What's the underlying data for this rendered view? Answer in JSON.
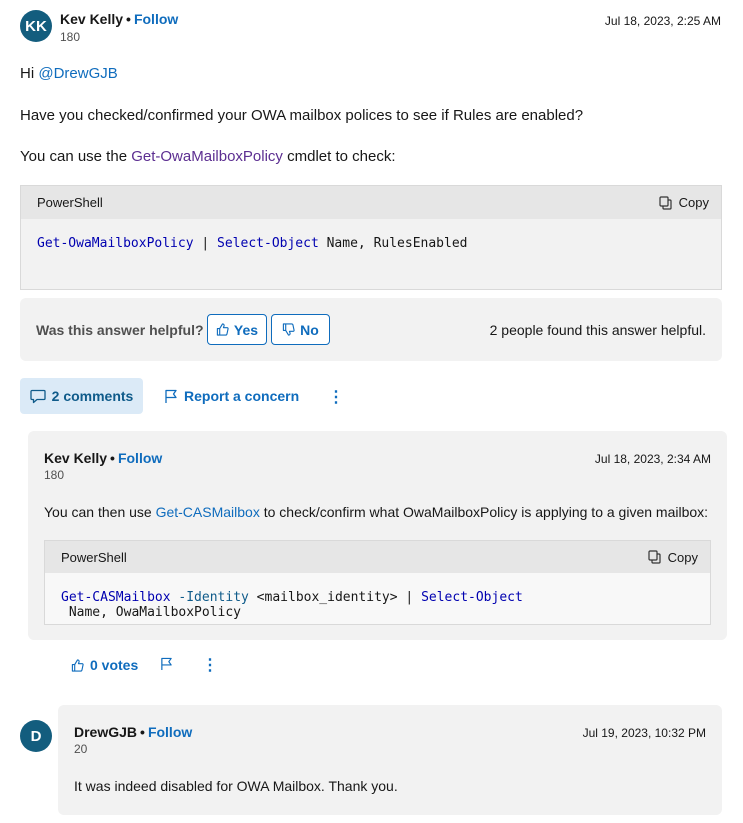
{
  "answer": {
    "author": {
      "initials": "KK",
      "name": "Kev Kelly",
      "separator": "•",
      "follow": "Follow",
      "reputation": "180"
    },
    "date": "Jul 18, 2023, 2:25 AM",
    "greeting_prefix": "Hi ",
    "mention": "@DrewGJB",
    "paragraph1": "Have you checked/confirmed your OWA mailbox polices to see if Rules are enabled?",
    "paragraph2_prefix": "You can use the ",
    "paragraph2_link": "Get-OwaMailboxPolicy",
    "paragraph2_suffix": " cmdlet to check:",
    "code": {
      "language": "PowerShell",
      "copy": "Copy",
      "cmd1": "Get-OwaMailboxPolicy",
      "pipe": " | ",
      "cmd2": "Select-Object",
      "args": " Name, RulesEnabled"
    },
    "helpful": {
      "question": "Was this answer helpful?",
      "yes": "Yes",
      "no": "No",
      "summary": "2 people found this answer helpful."
    },
    "actions": {
      "comments": "2 comments",
      "report": "Report a concern",
      "more": "⋮"
    }
  },
  "comments": [
    {
      "author": {
        "name": "Kev Kelly",
        "separator": "•",
        "follow": "Follow",
        "reputation": "180"
      },
      "date": "Jul 18, 2023, 2:34 AM",
      "text_prefix": "You can then use ",
      "text_link": "Get-CASMailbox",
      "text_suffix": " to check/confirm what OwaMailboxPolicy is applying to a given mailbox:",
      "code": {
        "language": "PowerShell",
        "copy": "Copy",
        "cmd1": "Get-CASMailbox",
        "param": " -Identity",
        "arg1": " <mailbox_identity>",
        "pipe": " | ",
        "cmd2": "Select-Object",
        "args": " Name, OwaMailboxPolicy"
      },
      "votes": "0 votes",
      "more": "⋮"
    },
    {
      "author": {
        "initials": "D",
        "name": "DrewGJB",
        "separator": "•",
        "follow": "Follow",
        "reputation": "20"
      },
      "date": "Jul 19, 2023, 10:32 PM",
      "text": "It was indeed disabled for OWA Mailbox. Thank you."
    }
  ]
}
